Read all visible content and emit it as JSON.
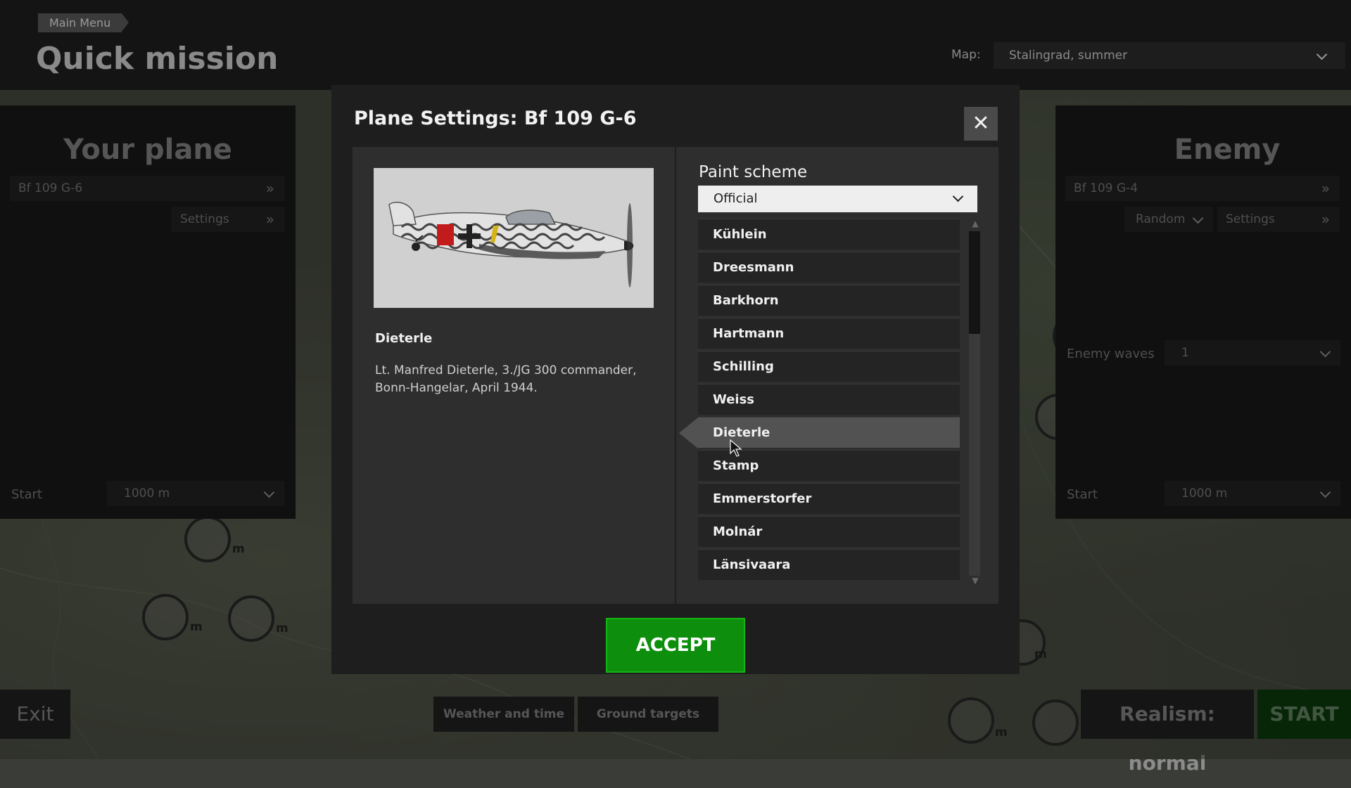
{
  "header": {
    "breadcrumb": "Main Menu",
    "title": "Quick mission",
    "map_label": "Map:",
    "map_value": "Stalingrad, summer"
  },
  "left_panel": {
    "title": "Your plane",
    "plane": "Bf 109 G-6",
    "settings": "Settings",
    "start_label": "Start",
    "start_value": "1000 m"
  },
  "right_panel": {
    "title": "Enemy",
    "plane": "Bf 109 G-4",
    "random": "Random",
    "settings": "Settings",
    "waves_label": "Enemy waves",
    "waves_value": "1",
    "start_label": "Start",
    "start_value": "1000 m"
  },
  "markers": {
    "dist_label": "m"
  },
  "bottom_bar": {
    "exit": "Exit",
    "weather": "Weather and time",
    "ground": "Ground targets",
    "realism": "Realism: normal",
    "start": "START"
  },
  "modal": {
    "title": "Plane Settings: Bf 109 G-6",
    "close_icon": "close-icon",
    "selected_skin": "Dieterle",
    "skin_description": "Lt. Manfred Dieterle, 3./JG 300 commander, Bonn-Hangelar, April 1944.",
    "paint_label": "Paint scheme",
    "paint_value": "Official",
    "skins": [
      "Kühlein",
      "Dreesmann",
      "Barkhorn",
      "Hartmann",
      "Schilling",
      "Weiss",
      "Dieterle",
      "Stamp",
      "Emmerstorfer",
      "Molnár",
      "Länsivaara"
    ],
    "selected_index": 6,
    "scroll_fraction": 0.0,
    "accept": "ACCEPT"
  },
  "colors": {
    "accept": "#0d8f0d",
    "start": "#0c3d0c",
    "selected_row": "#525252"
  }
}
